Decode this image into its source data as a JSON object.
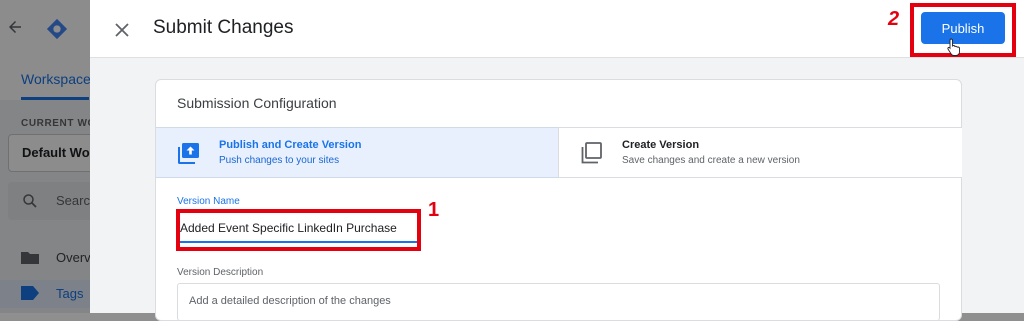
{
  "background": {
    "tabs": {
      "workspace": "Workspace"
    },
    "sidebar": {
      "current_workspace_label": "CURRENT WO",
      "workspace_name": "Default Wor",
      "search_placeholder": "Searc",
      "items": [
        {
          "label": "Overv",
          "icon": "folder-icon"
        },
        {
          "label": "Tags",
          "icon": "tag-icon"
        }
      ]
    }
  },
  "panel": {
    "title": "Submit Changes",
    "publish_label": "Publish",
    "card": {
      "title": "Submission Configuration",
      "options": [
        {
          "title": "Publish and Create Version",
          "subtitle": "Push changes to your sites",
          "icon": "publish-upload-icon",
          "selected": true
        },
        {
          "title": "Create Version",
          "subtitle": "Save changes and create a new version",
          "icon": "copy-icon",
          "selected": false
        }
      ],
      "version_name": {
        "label": "Version Name",
        "value": "Added Event Specific LinkedIn Purchase"
      },
      "version_description": {
        "label": "Version Description",
        "placeholder": "Add a detailed description of the changes"
      }
    }
  },
  "annotations": {
    "step_1": "1",
    "step_2": "2",
    "color": "#e50010"
  },
  "colors": {
    "accent": "#1a73e8",
    "selected_bg": "#e8f0fe"
  }
}
